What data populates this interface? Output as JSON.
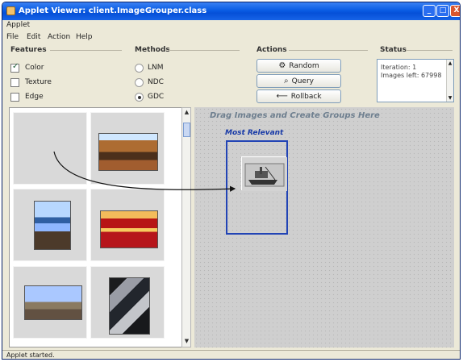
{
  "window": {
    "title": "Applet Viewer: client.ImageGrouper.class",
    "controls": [
      "_",
      "□",
      "X"
    ]
  },
  "applet_menu": "Applet",
  "menubar": [
    "File",
    "Edit",
    "Action",
    "Help"
  ],
  "features": {
    "label": "Features",
    "items": [
      {
        "label": "Color",
        "checked": true
      },
      {
        "label": "Texture",
        "checked": false
      },
      {
        "label": "Edge",
        "checked": false
      }
    ]
  },
  "methods": {
    "label": "Methods",
    "items": [
      {
        "label": "LNM",
        "selected": false
      },
      {
        "label": "NDC",
        "selected": false
      },
      {
        "label": "GDC",
        "selected": true
      }
    ]
  },
  "actions": {
    "label": "Actions",
    "random": "Random",
    "query": "Query",
    "rollback": "Rollback"
  },
  "status": {
    "label": "Status",
    "lines": [
      "Iteration: 1",
      "Images left: 67998"
    ]
  },
  "workspace": {
    "hint": "Drag Images and Create Groups Here",
    "group_title": "Most Relevant"
  },
  "statusbar": "Applet started.",
  "icons": {
    "random_icon": "gear-icon",
    "query_icon": "magnifier-icon",
    "rollback_icon": "back-arrow-icon"
  }
}
